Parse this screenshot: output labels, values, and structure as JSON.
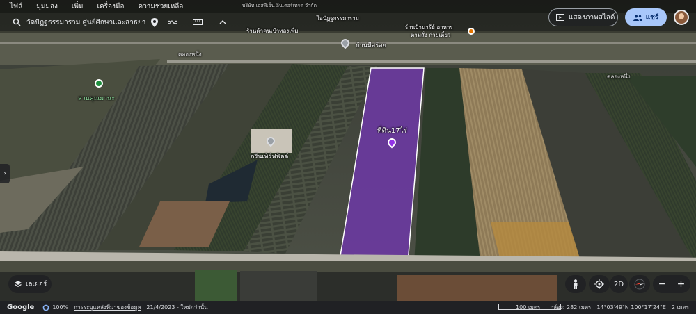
{
  "menu": [
    "ไฟล์",
    "มุมมอง",
    "เพิ่ม",
    "เครื่องมือ",
    "ความช่วยเหลือ"
  ],
  "search": {
    "query": "วัดปัฏฐธรรมาราม ศูนย์ศึกษาและสาธยา",
    "icons": [
      "search-icon",
      "place-icon",
      "route-icon",
      "ruler-icon",
      "chevron-up-icon"
    ]
  },
  "header": {
    "slideshow_label": "แสดงภาพสไลด์",
    "share_label": "แชร์"
  },
  "map_labels": {
    "ban_mi_sroy": "บ้านมีสร้อย",
    "suan_khum_ma_na": "สวนคุณมานะ",
    "green_turf": "กรีนเทิร์ฟฟิลด์",
    "plot": "ที่ดิน17ไร่",
    "canal_1": "คลองหนึ่ง",
    "canal_2": "คลองหนึ่ง",
    "industrial_office": "ไอปัฏฐกรรมาราม",
    "company": "บริษัท เอสพีเอ็น อินเตอร์เทรด จำกัด",
    "store_top": "ร้านค้าคนเป้าทองเพิ่ม",
    "shop_right": "ร้านป้านารีย์ อาหาร",
    "shop_right2": "ตามสั่ง ก๋วยเตี๋ยว",
    "road_right": "คลองหนึ่ง"
  },
  "controls": {
    "layers_label": "เลเยอร์",
    "mode_2d": "2D"
  },
  "status": {
    "brand": "Google",
    "zoom": "100%",
    "data_attribution": "การระบุแหล่งที่มาของข้อมูล",
    "imagery_date": "21/4/2023 - ใหม่กว่านั้น",
    "scale_label": "100 เมตร",
    "camera": "กล้อง: 282 เมตร",
    "coords": "14°03'49\"N 100°17'24\"E",
    "altitude": "2 เมตร"
  },
  "colors": {
    "plot_fill": "#7b3fb5",
    "plot_stroke": "#ffffff",
    "share_bg": "#a8c7fa",
    "bar_bg": "#202124"
  }
}
